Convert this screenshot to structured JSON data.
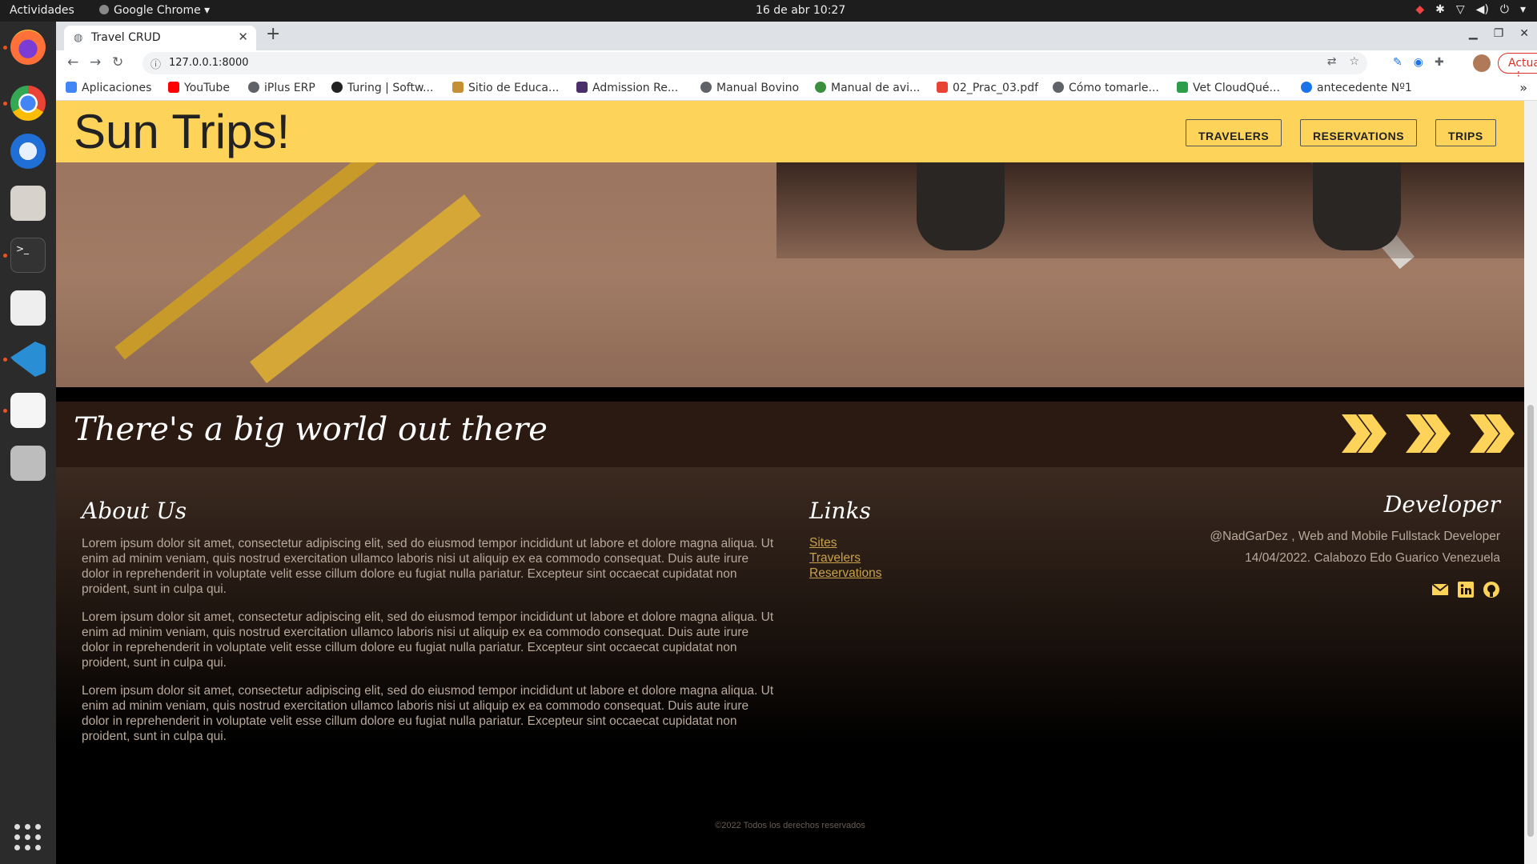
{
  "os": {
    "activities": "Actividades",
    "app_menu": "Google Chrome",
    "clock": "16 de abr  10:27"
  },
  "browser": {
    "tab_title": "Travel CRUD",
    "url": "127.0.0.1:8000",
    "update_button": "Actualizar",
    "bookmarks": [
      {
        "label": "Aplicaciones",
        "color": "#4285f4"
      },
      {
        "label": "YouTube",
        "color": "#ff0000"
      },
      {
        "label": "iPlus ERP",
        "color": "#5f6368"
      },
      {
        "label": "Turing | Softw...",
        "color": "#222222"
      },
      {
        "label": "Sitio de Educa...",
        "color": "#c58f34"
      },
      {
        "label": "Admission Re...",
        "color": "#4a2f6b"
      },
      {
        "label": "Manual Bovino",
        "color": "#5f6368"
      },
      {
        "label": "Manual de avi...",
        "color": "#3c8f3c"
      },
      {
        "label": "02_Prac_03.pdf",
        "color": "#e94335"
      },
      {
        "label": "Cómo tomarle...",
        "color": "#5f6368"
      },
      {
        "label": "Vet CloudQué...",
        "color": "#2e9d4a"
      },
      {
        "label": "antecedente Nº1",
        "color": "#1a73e8"
      }
    ]
  },
  "site": {
    "brand": "Sun Trips!",
    "nav": [
      "TRAVELERS",
      "RESERVATIONS",
      "TRIPS"
    ],
    "tagline": "There's a big world out there",
    "accent": "#fdd35a"
  },
  "footer": {
    "about_title": "About Us",
    "about_paragraphs": [
      "Lorem ipsum dolor sit amet, consectetur adipiscing elit, sed do eiusmod tempor incididunt ut labore et dolore magna aliqua. Ut enim ad minim veniam, quis nostrud exercitation ullamco laboris nisi ut aliquip ex ea commodo consequat. Duis aute irure dolor in reprehenderit in voluptate velit esse cillum dolore eu fugiat nulla pariatur. Excepteur sint occaecat cupidatat non proident, sunt in culpa qui.",
      "Lorem ipsum dolor sit amet, consectetur adipiscing elit, sed do eiusmod tempor incididunt ut labore et dolore magna aliqua. Ut enim ad minim veniam, quis nostrud exercitation ullamco laboris nisi ut aliquip ex ea commodo consequat. Duis aute irure dolor in reprehenderit in voluptate velit esse cillum dolore eu fugiat nulla pariatur. Excepteur sint occaecat cupidatat non proident, sunt in culpa qui.",
      "Lorem ipsum dolor sit amet, consectetur adipiscing elit, sed do eiusmod tempor incididunt ut labore et dolore magna aliqua. Ut enim ad minim veniam, quis nostrud exercitation ullamco laboris nisi ut aliquip ex ea commodo consequat. Duis aute irure dolor in reprehenderit in voluptate velit esse cillum dolore eu fugiat nulla pariatur. Excepteur sint occaecat cupidatat non proident, sunt in culpa qui."
    ],
    "links_title": "Links",
    "links": [
      "Sites",
      "Travelers",
      "Reservations"
    ],
    "developer_title": "Developer",
    "developer_line1": "@NadGarDez , Web and Mobile Fullstack Developer",
    "developer_line2": "14/04/2022. Calabozo Edo Guarico Venezuela",
    "developer_icons": [
      "mail-icon",
      "linkedin-icon",
      "github-icon"
    ],
    "copyright": "©2022 Todos los derechos reservados"
  }
}
